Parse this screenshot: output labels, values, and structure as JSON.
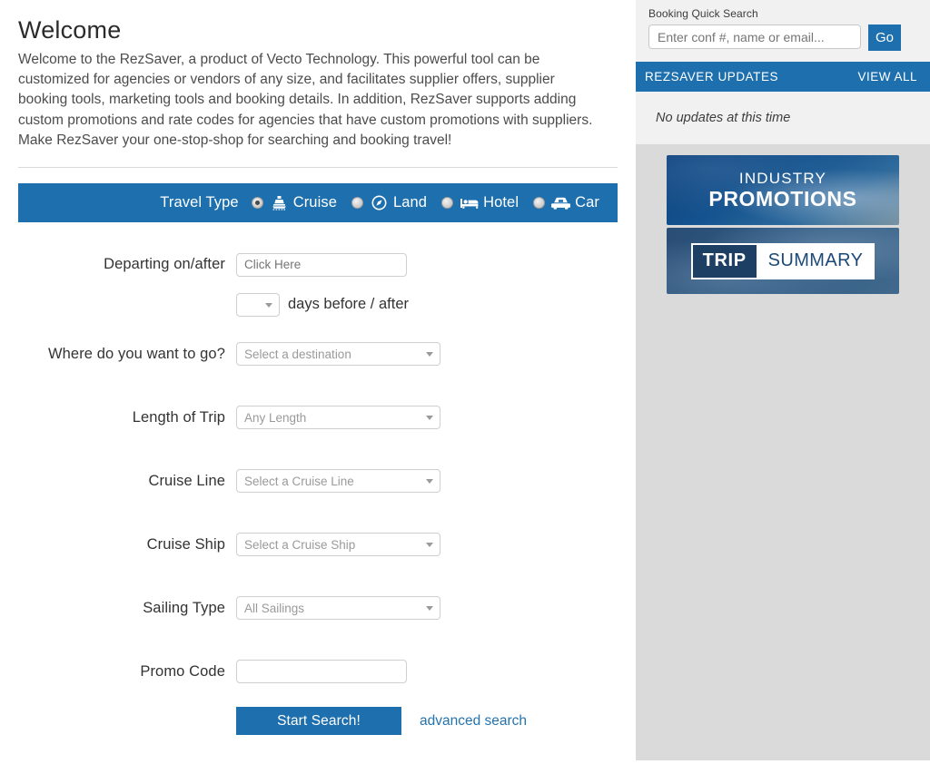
{
  "main": {
    "welcome_title": "Welcome",
    "welcome_body": "Welcome to the RezSaver, a product of Vecto Technology. This powerful tool can be customized for agencies or vendors of any size, and facilitates supplier offers, supplier booking tools, marketing tools and booking details. In addition, RezSaver supports adding custom promotions and rate codes for agencies that have custom promotions with suppliers. Make RezSaver your one-stop-shop for searching and booking travel!",
    "travel_type": {
      "label": "Travel Type",
      "options": [
        {
          "label": "Cruise",
          "icon": "ship-icon",
          "selected": true
        },
        {
          "label": "Land",
          "icon": "compass-icon",
          "selected": false
        },
        {
          "label": "Hotel",
          "icon": "bed-icon",
          "selected": false
        },
        {
          "label": "Car",
          "icon": "car-icon",
          "selected": false
        }
      ]
    },
    "form": {
      "departing_label": "Departing on/after",
      "departing_placeholder": "Click Here",
      "departing_value": "",
      "days_value": "",
      "days_suffix": "days before / after",
      "destination_label": "Where do you want to go?",
      "destination_value": "Select a destination",
      "length_label": "Length of Trip",
      "length_value": "Any Length",
      "cruise_line_label": "Cruise Line",
      "cruise_line_value": "Select a Cruise Line",
      "cruise_ship_label": "Cruise Ship",
      "cruise_ship_value": "Select a Cruise Ship",
      "sailing_type_label": "Sailing Type",
      "sailing_type_value": "All Sailings",
      "promo_code_label": "Promo Code",
      "promo_code_value": "",
      "start_search_label": "Start Search!",
      "advanced_search_label": "advanced search"
    }
  },
  "sidebar": {
    "quick_search": {
      "label": "Booking Quick Search",
      "placeholder": "Enter conf #, name or email...",
      "value": "",
      "go_label": "Go"
    },
    "updates": {
      "title": "REZSAVER UPDATES",
      "view_all_label": "VIEW ALL",
      "empty_message": "No updates at this time"
    },
    "banners": [
      {
        "line1": "INDUSTRY",
        "line2": "PROMOTIONS"
      },
      {
        "left": "TRIP",
        "right": "SUMMARY"
      }
    ]
  },
  "colors": {
    "brand_blue": "#1e6fae",
    "sidebar_bg": "#dadada",
    "panel_bg": "#f1f1f1",
    "link_blue": "#2573ad"
  }
}
